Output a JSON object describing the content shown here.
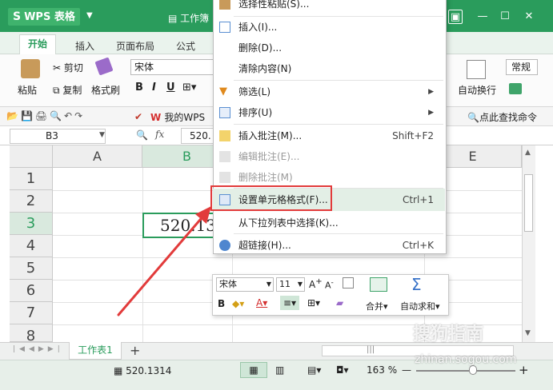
{
  "titlebar": {
    "app_name": "WPS 表格",
    "doc_title": "工作簿",
    "colors": {
      "brand": "#2a9c5c"
    }
  },
  "ribbon_tabs": [
    "开始",
    "插入",
    "页面布局",
    "公式"
  ],
  "ribbon": {
    "paste": "粘贴",
    "cut": "剪切",
    "copy": "复制",
    "format_painter": "格式刷",
    "font_name": "宋体",
    "bold": "B",
    "italic": "I",
    "underline": "U",
    "wrap_text": "自动换行",
    "number_format": "常规"
  },
  "quickbar": {
    "my_wps": "我的WPS",
    "find": "点此查找命令"
  },
  "formula_bar": {
    "name_box": "B3",
    "fx": "fx",
    "value": "520."
  },
  "grid": {
    "columns": [
      "A",
      "B",
      "E"
    ],
    "rows": [
      "1",
      "2",
      "3",
      "4",
      "5",
      "6",
      "7",
      "8"
    ],
    "b3_value": "520.13"
  },
  "context_menu": {
    "items": [
      {
        "label": "选择性粘贴(S)...",
        "shortcut": "",
        "disabled": false
      },
      {
        "label": "插入(I)...",
        "shortcut": "",
        "disabled": false
      },
      {
        "label": "删除(D)...",
        "shortcut": "",
        "disabled": false
      },
      {
        "label": "清除内容(N)",
        "shortcut": "",
        "disabled": false
      },
      {
        "label": "筛选(L)",
        "shortcut": "",
        "disabled": false
      },
      {
        "label": "排序(U)",
        "shortcut": "",
        "disabled": false
      },
      {
        "label": "插入批注(M)...",
        "shortcut": "Shift+F2",
        "disabled": false
      },
      {
        "label": "编辑批注(E)...",
        "shortcut": "",
        "disabled": true
      },
      {
        "label": "删除批注(M)",
        "shortcut": "",
        "disabled": true
      },
      {
        "label": "设置单元格格式(F)...",
        "shortcut": "Ctrl+1",
        "disabled": false
      },
      {
        "label": "从下拉列表中选择(K)...",
        "shortcut": "",
        "disabled": false
      },
      {
        "label": "超链接(H)...",
        "shortcut": "Ctrl+K",
        "disabled": false
      }
    ]
  },
  "mini_toolbar": {
    "font": "宋体",
    "size": "11",
    "bold": "B",
    "merge": "合并",
    "autosum": "自动求和"
  },
  "sheets": {
    "active": "工作表1",
    "add": "+"
  },
  "statusbar": {
    "sum_value": "520.1314",
    "zoom": "163 %"
  },
  "watermark": {
    "brand": "搜狗指南",
    "url": "zhinan.sogou.com"
  }
}
